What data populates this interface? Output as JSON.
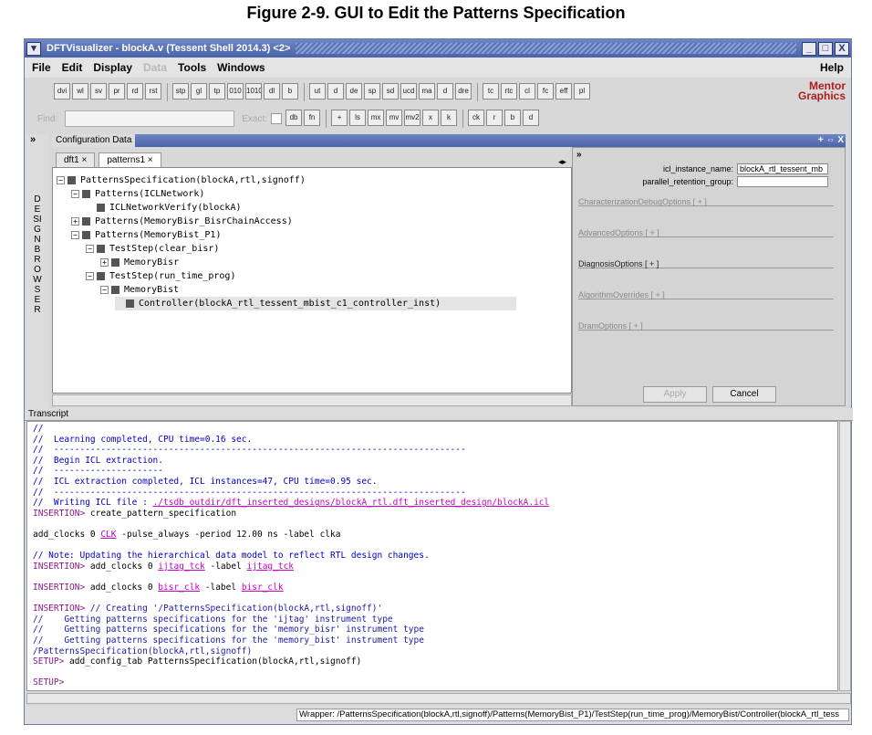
{
  "figure_title": "Figure 2-9. GUI to Edit the Patterns Specification",
  "window": {
    "title": "DFTVisualizer - blockA.v  (Tessent Shell 2014.3) <2>",
    "controls": [
      "_",
      "□",
      "X"
    ]
  },
  "menu": {
    "file": "File",
    "edit": "Edit",
    "display": "Display",
    "data": "Data",
    "tools": "Tools",
    "windows": "Windows",
    "help": "Help"
  },
  "toolbar": {
    "logo_line1": "Mentor",
    "logo_line2": "Graphics",
    "buttons": [
      "dvi",
      "wl",
      "sv",
      "pr",
      "rd",
      "rst",
      "stp",
      "gl",
      "tp",
      "010",
      "1010",
      "dl",
      "b",
      "ut",
      "d",
      "de",
      "sp",
      "sd",
      "ucd",
      "ma",
      "d",
      "dre",
      "tc",
      "rtc",
      "cl",
      "fc",
      "eff",
      "pl"
    ],
    "find_label": "Find:",
    "exact_label": "Exact:",
    "tool2_buttons": [
      "db",
      "fn",
      "+",
      "ls",
      "mx",
      "mv",
      "mv2",
      "x",
      "k",
      "ck",
      "r",
      "b",
      "d"
    ]
  },
  "sidebar": {
    "arrow": "»",
    "label": "DESIGN BROWSER"
  },
  "config": {
    "header": "Configuration Data",
    "tabs": [
      {
        "label": "dft1",
        "active": false
      },
      {
        "label": "patterns1",
        "active": true
      }
    ],
    "tab_close": "×",
    "tab_nav": "◂▸",
    "ctrls": "+ ⇔ X"
  },
  "tree": [
    {
      "label": "PatternsSpecification(blockA,rtl,signoff)",
      "depth": 0,
      "exp": "−"
    },
    {
      "label": "Patterns(ICLNetwork)",
      "depth": 1,
      "exp": "−"
    },
    {
      "label": "ICLNetworkVerify(blockA)",
      "depth": 2,
      "exp": ""
    },
    {
      "label": "Patterns(MemoryBisr_BisrChainAccess)",
      "depth": 1,
      "exp": "+"
    },
    {
      "label": "Patterns(MemoryBist_P1)",
      "depth": 1,
      "exp": "−"
    },
    {
      "label": "TestStep(clear_bisr)",
      "depth": 2,
      "exp": "−"
    },
    {
      "label": "MemoryBisr",
      "depth": 3,
      "exp": "+"
    },
    {
      "label": "TestStep(run_time_prog)",
      "depth": 2,
      "exp": "−"
    },
    {
      "label": "MemoryBist",
      "depth": 3,
      "exp": "−"
    },
    {
      "label": "Controller(blockA_rtl_tessent_mbist_c1_controller_inst)",
      "depth": 4,
      "exp": "",
      "selected": true
    }
  ],
  "props": {
    "rows": [
      {
        "key": "icl_instance_name:",
        "value": "blockA_rtl_tessent_mb"
      },
      {
        "key": "parallel_retention_group:",
        "value": ""
      }
    ],
    "sections": [
      {
        "label": "CharacterizationDebugOptions [ + ]",
        "dark": false
      },
      {
        "label": "AdvancedOptions [ + ]",
        "dark": false
      },
      {
        "label": "DiagnosisOptions [ + ]",
        "dark": true
      },
      {
        "label": "AlgorithmOverrides [ + ]",
        "dark": false
      },
      {
        "label": "DramOptions [ + ]",
        "dark": false
      }
    ],
    "apply": "Apply",
    "cancel": "Cancel"
  },
  "transcript": {
    "header": "Transcript",
    "lines": [
      [
        {
          "t": "//",
          "c": "blue"
        }
      ],
      [
        {
          "t": "//  Learning completed, CPU time=0.16 sec.",
          "c": "blue"
        }
      ],
      [
        {
          "t": "//  -------------------------------------------------------------------------------",
          "c": "blue"
        }
      ],
      [
        {
          "t": "//  Begin ICL extraction.",
          "c": "blue"
        }
      ],
      [
        {
          "t": "//  ---------------------",
          "c": "blue"
        }
      ],
      [
        {
          "t": "//  ICL extraction completed, ICL instances=47, CPU time=0.95 sec.",
          "c": "blue"
        }
      ],
      [
        {
          "t": "//  -------------------------------------------------------------------------------",
          "c": "blue"
        }
      ],
      [
        {
          "t": "//  Writing ICL file : ",
          "c": "blue"
        },
        {
          "t": "./tsdb_outdir/dft_inserted_designs/blockA_rtl.dft_inserted_design/blockA.icl",
          "c": "magenta"
        }
      ],
      [
        {
          "t": "INSERTION> ",
          "c": "purple"
        },
        {
          "t": "create_pattern_specification",
          "c": ""
        }
      ],
      [
        {
          "t": "",
          "c": ""
        }
      ],
      [
        {
          "t": "add_clocks 0 ",
          "c": ""
        },
        {
          "t": "CLK",
          "c": "magenta"
        },
        {
          "t": " -pulse_always -period 12.00 ns -label clka",
          "c": ""
        }
      ],
      [
        {
          "t": "",
          "c": ""
        }
      ],
      [
        {
          "t": "// Note: Updating the hierarchical data model to reflect RTL design changes.",
          "c": "blue"
        }
      ],
      [
        {
          "t": "INSERTION> ",
          "c": "purple"
        },
        {
          "t": "add_clocks 0 ",
          "c": ""
        },
        {
          "t": "ijtag_tck",
          "c": "magenta"
        },
        {
          "t": " -label ",
          "c": ""
        },
        {
          "t": "ijtag_tck",
          "c": "magenta"
        }
      ],
      [
        {
          "t": "",
          "c": ""
        }
      ],
      [
        {
          "t": "INSERTION> ",
          "c": "purple"
        },
        {
          "t": "add_clocks 0 ",
          "c": ""
        },
        {
          "t": "bisr_clk",
          "c": "magenta"
        },
        {
          "t": " -label ",
          "c": ""
        },
        {
          "t": "bisr_clk",
          "c": "magenta"
        }
      ],
      [
        {
          "t": "",
          "c": ""
        }
      ],
      [
        {
          "t": "INSERTION> ",
          "c": "purple"
        },
        {
          "t": "// Creating '/PatternsSpecification(blockA,rtl,signoff)'",
          "c": "navy"
        }
      ],
      [
        {
          "t": "//    Getting patterns specifications for the 'ijtag' instrument type",
          "c": "navy"
        }
      ],
      [
        {
          "t": "//    Getting patterns specifications for the 'memory_bisr' instrument type",
          "c": "navy"
        }
      ],
      [
        {
          "t": "//    Getting patterns specifications for the 'memory_bist' instrument type",
          "c": "navy"
        }
      ],
      [
        {
          "t": "/PatternsSpecification(blockA,rtl,signoff)",
          "c": "navy"
        }
      ],
      [
        {
          "t": "SETUP> ",
          "c": "purple"
        },
        {
          "t": "add_config_tab PatternsSpecification(blockA,rtl,signoff)",
          "c": ""
        }
      ],
      [
        {
          "t": "",
          "c": ""
        }
      ],
      [
        {
          "t": "SETUP>",
          "c": "purple"
        }
      ]
    ]
  },
  "status": {
    "text": "Wrapper: /PatternsSpecification(blockA,rtl,signoff)/Patterns(MemoryBist_P1)/TestStep(run_time_prog)/MemoryBist/Controller(blockA_rtl_tess"
  },
  "colors": {
    "titlebar": "#4a64a8",
    "logo": "#b01c1c",
    "transcript_comment": "#0000c8",
    "transcript_prompt": "#8b1a8b",
    "transcript_link": "#c800c8"
  }
}
